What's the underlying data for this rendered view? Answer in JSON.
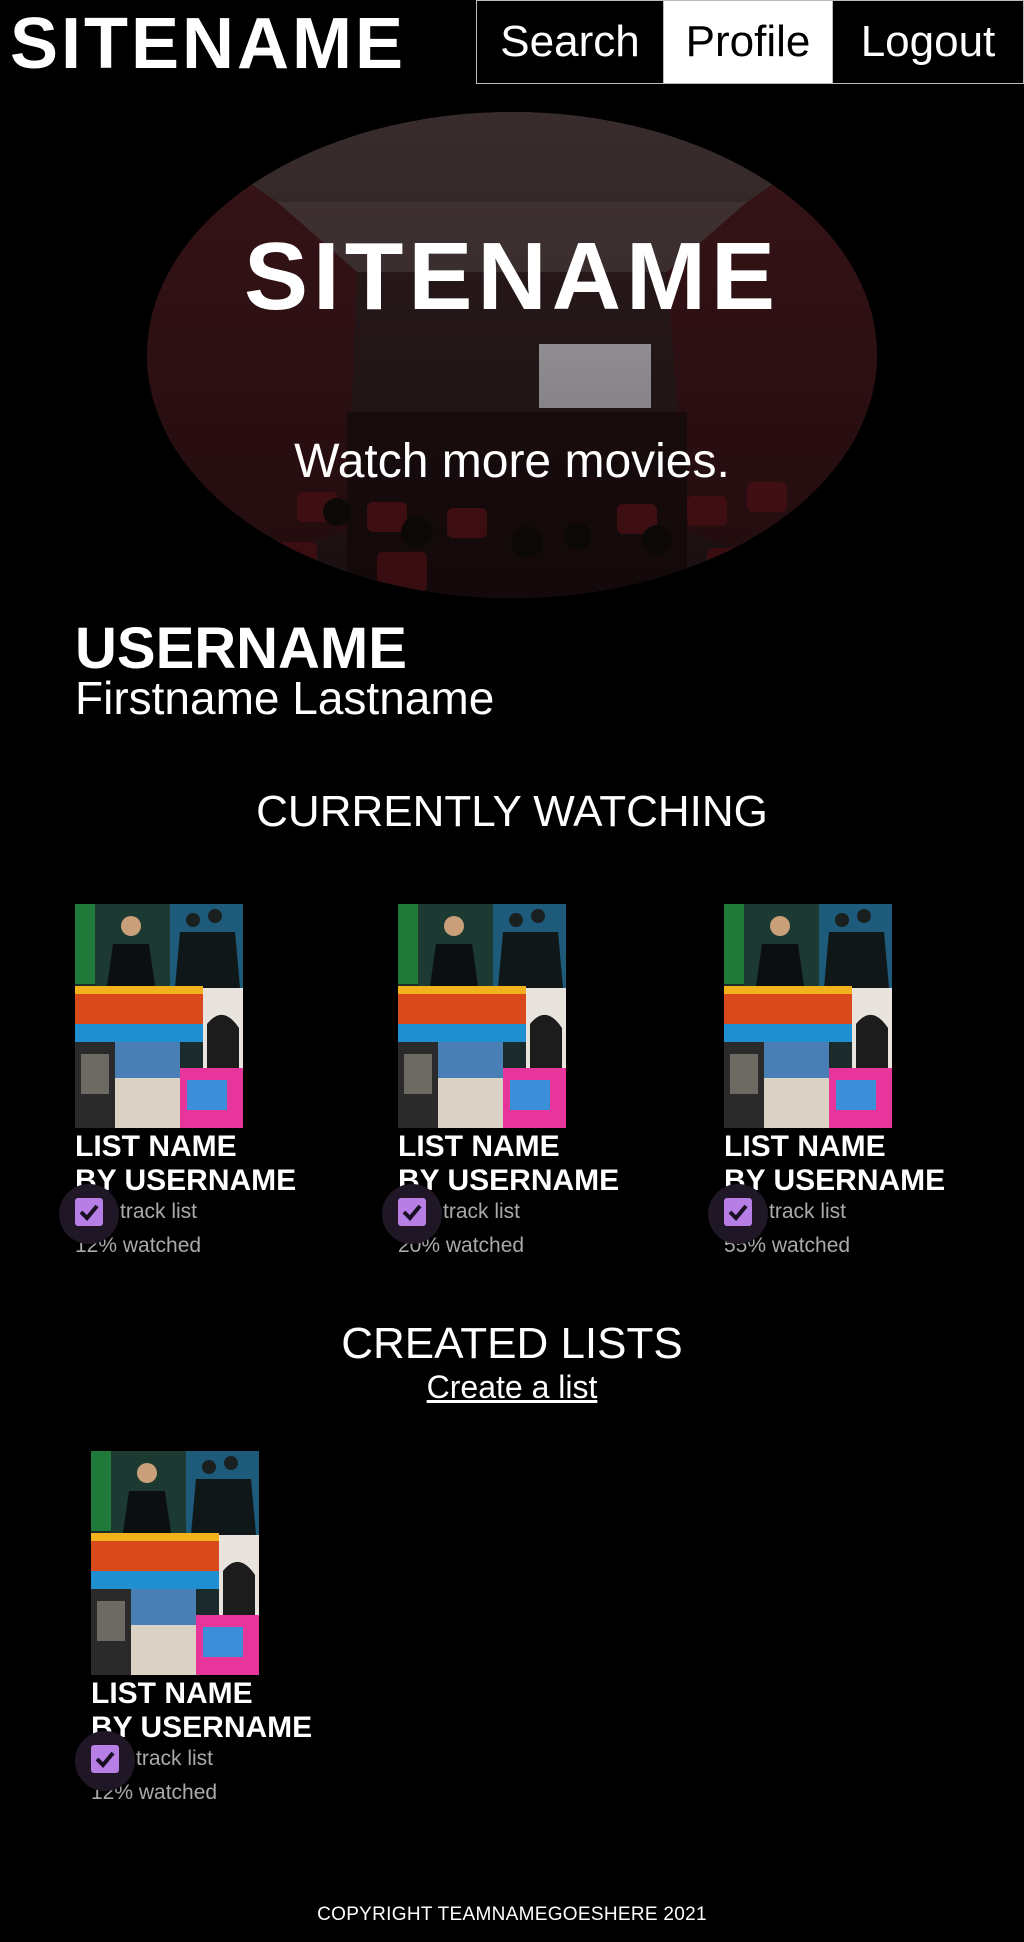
{
  "header": {
    "logo": "SITENAME",
    "nav": [
      {
        "label": "Search"
      },
      {
        "label": "Profile"
      },
      {
        "label": "Logout"
      }
    ]
  },
  "hero": {
    "title": "SITENAME",
    "tagline": "Watch more movies."
  },
  "profile": {
    "username": "USERNAME",
    "full_name": "Firstname Lastname"
  },
  "currently_watching": {
    "title": "CURRENTLY WATCHING",
    "cards": [
      {
        "name": "LIST NAME",
        "by": "BY USERNAME",
        "track": "track list",
        "tracked": true,
        "watched_text": "12% watched",
        "watched": 0.12
      },
      {
        "name": "LIST NAME",
        "by": "BY USERNAME",
        "track": "track list",
        "tracked": true,
        "watched_text": "20% watched",
        "watched": 0.2
      },
      {
        "name": "LIST NAME",
        "by": "BY USERNAME",
        "track": "track list",
        "tracked": true,
        "watched_text": "55% watched",
        "watched": 0.55
      }
    ]
  },
  "created_lists": {
    "title": "CREATED LISTS",
    "create_link": "Create a list",
    "cards": [
      {
        "name": "LIST NAME",
        "by": "BY USERNAME",
        "track": "track list",
        "tracked": true,
        "watched_text": "12% watched",
        "watched": 0.12
      }
    ]
  },
  "footer": {
    "copyright": "COPYRIGHT TEAMNAMEGOESHERE 2021"
  },
  "colors": {
    "background": "#000000",
    "text": "#ffffff",
    "checkbox": "#b77ee6",
    "muted_text": "#aaaaaa"
  },
  "icons": {
    "checkbox": "check-icon",
    "poster": "movie-poster-collage"
  }
}
